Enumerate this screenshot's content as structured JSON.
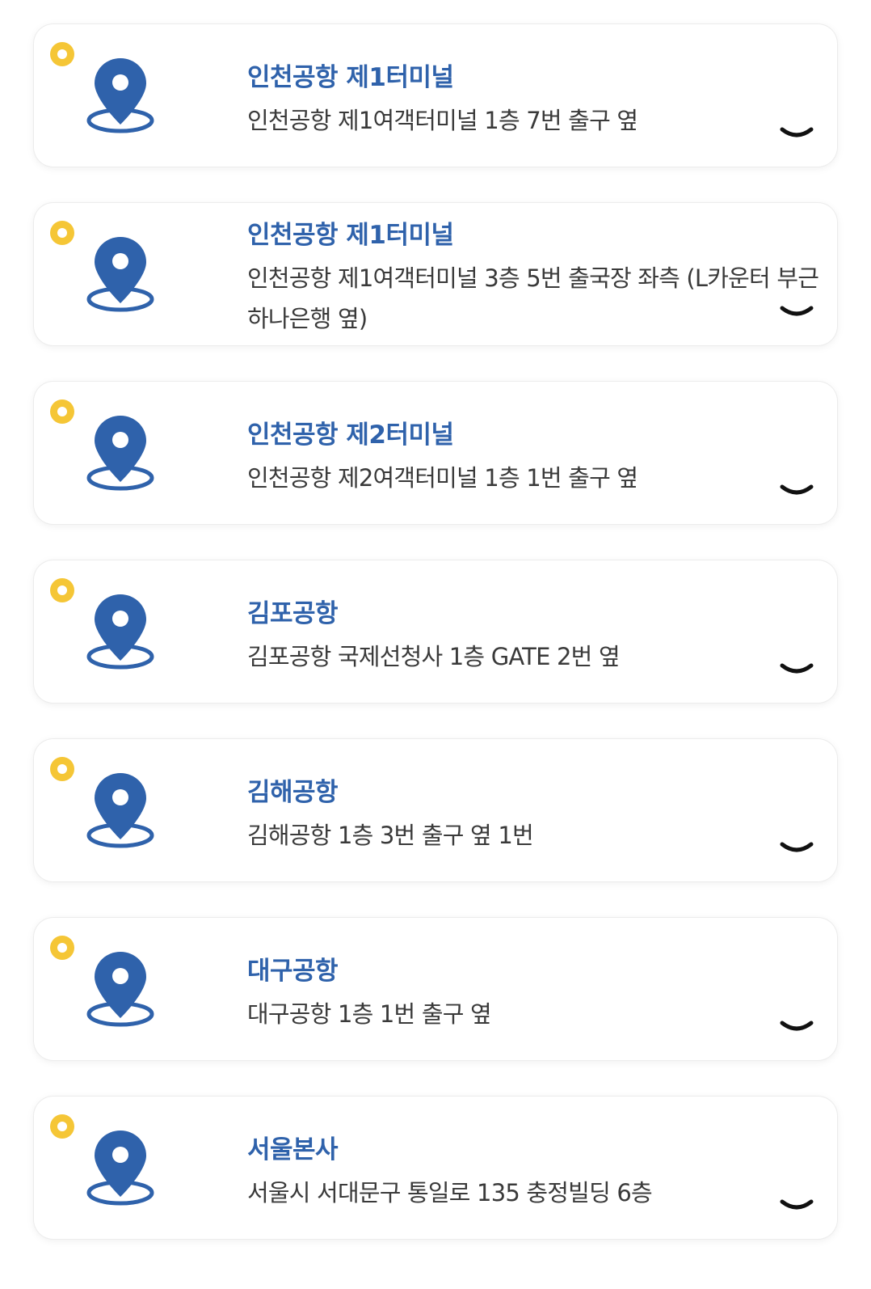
{
  "theme": {
    "title_color": "#2f62ab",
    "pin_color": "#2f62ab",
    "dot_color": "#f5c636",
    "address_color": "#3a3a3a"
  },
  "locations": [
    {
      "title": "인천공항 제1터미널",
      "address": "인천공항 제1여객터미널 1층 7번 출구 옆",
      "icon": "map-pin-icon",
      "toggle_icon": "chevron-down-icon"
    },
    {
      "title": "인천공항 제1터미널",
      "address": "인천공항 제1여객터미널 3층 5번 출국장 좌측 (L카운터 부근 하나은행 옆)",
      "icon": "map-pin-icon",
      "toggle_icon": "chevron-down-icon"
    },
    {
      "title": "인천공항 제2터미널",
      "address": "인천공항 제2여객터미널 1층 1번 출구 옆",
      "icon": "map-pin-icon",
      "toggle_icon": "chevron-down-icon"
    },
    {
      "title": "김포공항",
      "address": "김포공항 국제선청사 1층 GATE 2번 옆",
      "icon": "map-pin-icon",
      "toggle_icon": "chevron-down-icon"
    },
    {
      "title": "김해공항",
      "address": "김해공항 1층 3번 출구 옆 1번",
      "icon": "map-pin-icon",
      "toggle_icon": "chevron-down-icon"
    },
    {
      "title": "대구공항",
      "address": "대구공항 1층 1번 출구 옆",
      "icon": "map-pin-icon",
      "toggle_icon": "chevron-down-icon"
    },
    {
      "title": "서울본사",
      "address": "서울시 서대문구 통일로 135 충정빌딩 6층",
      "icon": "map-pin-icon",
      "toggle_icon": "chevron-down-icon"
    }
  ]
}
